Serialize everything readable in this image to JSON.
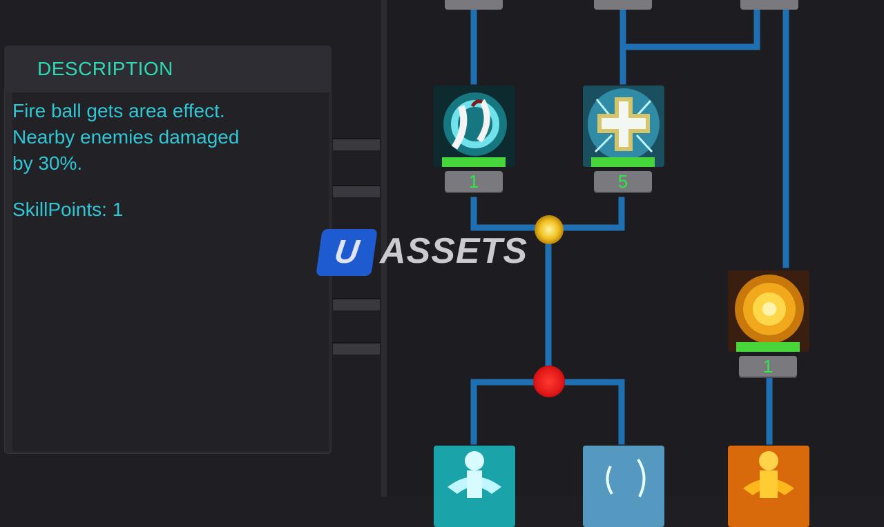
{
  "description": {
    "title": "DESCRIPTION",
    "text": "Fire  ball gets area effect.\nNearby enemies damaged\nby 30%.",
    "skill_points": "SkillPoints: 1"
  },
  "watermark": {
    "letter": "U",
    "word": "ASSETS"
  },
  "skills": [
    {
      "name": "skill-wind-slash",
      "level": "1"
    },
    {
      "name": "skill-heal-cross",
      "level": "5"
    },
    {
      "name": "skill-fire-nova",
      "level": "1"
    },
    {
      "name": "skill-water-spirit",
      "level": ""
    },
    {
      "name": "skill-frost-shard",
      "level": ""
    },
    {
      "name": "skill-fire-golem",
      "level": ""
    }
  ],
  "colors": {
    "accent_text": "#2fc7d6",
    "header_text": "#2fd9b5",
    "connector": "#1f6fb3",
    "progress_green": "#46d63a",
    "level_text": "#2ee84a",
    "joint_gold": "#e8b21a",
    "joint_red": "#e01616"
  }
}
